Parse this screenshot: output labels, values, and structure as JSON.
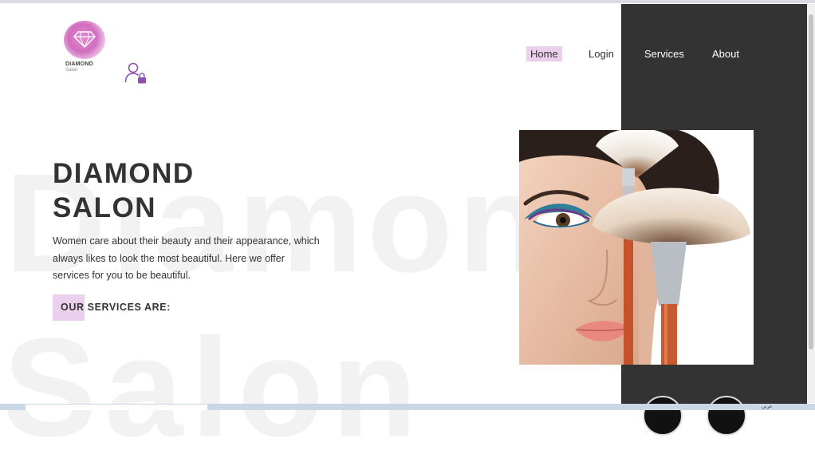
{
  "background_words": {
    "line1": "Diamond",
    "line2": "Salon"
  },
  "logo": {
    "name": "DIAMOND",
    "sub": "Salon"
  },
  "nav": {
    "home": "Home",
    "login": "Login",
    "services": "Services",
    "about": "About"
  },
  "hero": {
    "title_line1": "DIAMOND",
    "title_line2": "SALON",
    "description": "Women care about their beauty and their appearance, which always likes to look the most beautiful. Here we offer services for you to be beautiful.",
    "services_label": "OUR SERVICES ARE:"
  },
  "taskbar": {
    "tray_text": "عربي"
  },
  "colors": {
    "accent_highlight": "#ead0ec",
    "dark_panel": "#333333",
    "text": "#333333",
    "icon_purple": "#8e4fb5"
  },
  "icons": {
    "user": "user-lock-icon",
    "logo": "diamond-logo"
  }
}
